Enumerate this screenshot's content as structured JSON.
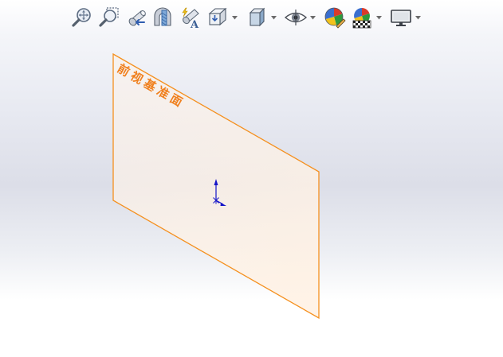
{
  "toolbar": {
    "buttons": [
      {
        "icon": "zoom-to-fit-icon"
      },
      {
        "icon": "zoom-to-area-icon"
      },
      {
        "icon": "previous-view-icon"
      },
      {
        "icon": "section-view-icon"
      },
      {
        "icon": "dynamic-annotation-views-icon"
      },
      {
        "icon": "view-orientation-icon",
        "dropdown": true
      },
      {
        "icon": "display-style-icon",
        "dropdown": true
      },
      {
        "icon": "hide-show-items-icon",
        "dropdown": true
      },
      {
        "icon": "edit-appearance-icon"
      },
      {
        "icon": "apply-scene-icon",
        "dropdown": true
      },
      {
        "icon": "view-settings-icon",
        "dropdown": true
      }
    ]
  },
  "plane": {
    "label": "前视基准面",
    "edge_color": "#f5901e",
    "fill_color": "#fcefe2"
  },
  "triad": {
    "y_color": "#1515c8",
    "x_color": "#1515c8"
  }
}
